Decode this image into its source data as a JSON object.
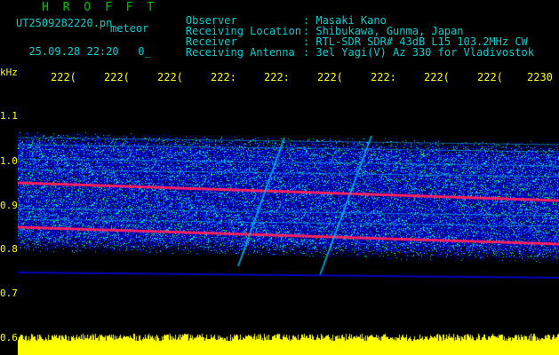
{
  "header": {
    "title": "H R O F F T",
    "filename": "UT2509282220.pn",
    "meteor_label": "meteor",
    "datetime": "25.09.28 22:20",
    "marker": "0_",
    "info": [
      {
        "label": "Observer",
        "value": ": Masaki Kano"
      },
      {
        "label": "Receiving Location",
        "value": ": Shibukawa, Gunma, Japan"
      },
      {
        "label": "Receiver",
        "value": ": RTL-SDR SDR# 43dB L15 103.2MHz CW"
      },
      {
        "label": "Receiving Antenna",
        "value": ": 3el Yagi(V) Az 330 for Vladivostok"
      }
    ]
  },
  "axis": {
    "y_unit": "kHz",
    "x_ticks": [
      "222(",
      "222(",
      "222(",
      "222:",
      "222:",
      "222(",
      "222:",
      "222(",
      "222(",
      "2230"
    ],
    "y_ticks": [
      "1.1",
      "1.0",
      "0.9",
      "0.8",
      "0.7",
      "0.6"
    ]
  },
  "colors": {
    "background": "#000000",
    "header_text": "#00d0d0",
    "title_text": "#00c000",
    "axis_text": "#ffff00",
    "noise_low": "#0000c0",
    "noise_mid": "#00c0ff",
    "noise_high": "#00ff60",
    "signal": "#ff2060",
    "baseline": "#ffff00"
  }
}
